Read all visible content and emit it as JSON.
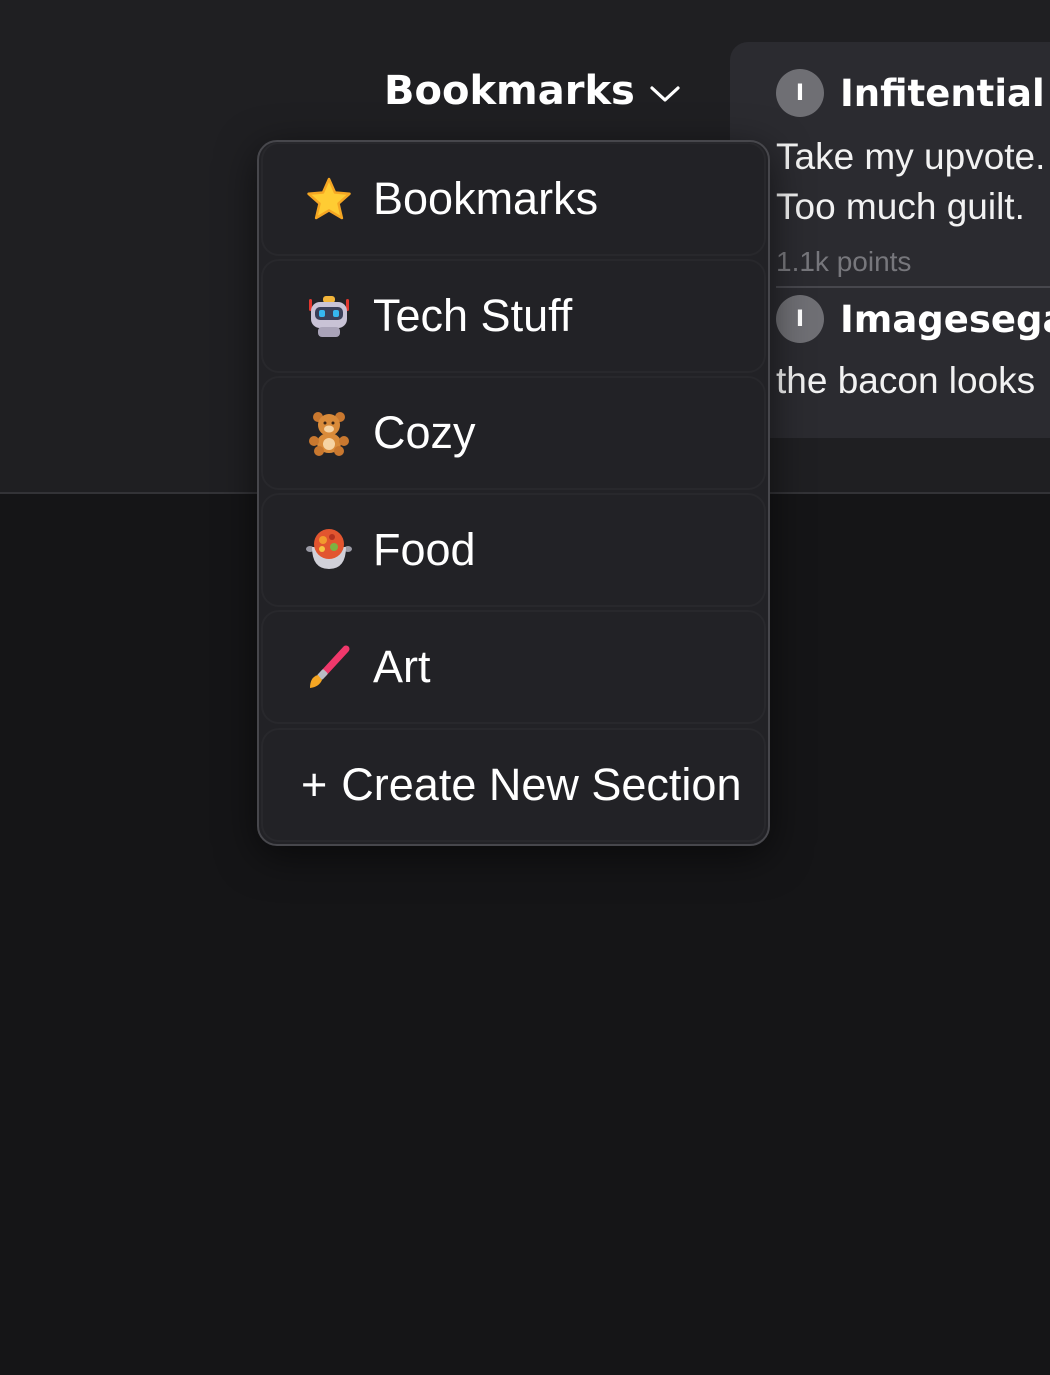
{
  "header": {
    "title": "Bookmarks",
    "dropdown_icon": "chevron-down-icon"
  },
  "comments": [
    {
      "avatar_letter": "I",
      "username": "Infitential",
      "text_line1": "Take my upvote.",
      "text_line2": "Too much guilt.",
      "points": "1.1k points"
    },
    {
      "avatar_letter": "I",
      "username": "Imagesegarden",
      "text_line1": "the bacon looks"
    }
  ],
  "menu": {
    "items": [
      {
        "label": "Bookmarks",
        "icon": "star-icon"
      },
      {
        "label": "Tech Stuff",
        "icon": "robot-icon"
      },
      {
        "label": "Cozy",
        "icon": "teddy-bear-icon"
      },
      {
        "label": "Food",
        "icon": "stew-pot-icon"
      },
      {
        "label": "Art",
        "icon": "paintbrush-icon"
      }
    ],
    "create_plus": "+",
    "create_label": "Create New Section"
  },
  "colors": {
    "page_background": "#151517",
    "panel_background": "#1f1f22",
    "menu_background": "#222226",
    "star": "#ffcc33",
    "brush_handle": "#f0386b"
  }
}
